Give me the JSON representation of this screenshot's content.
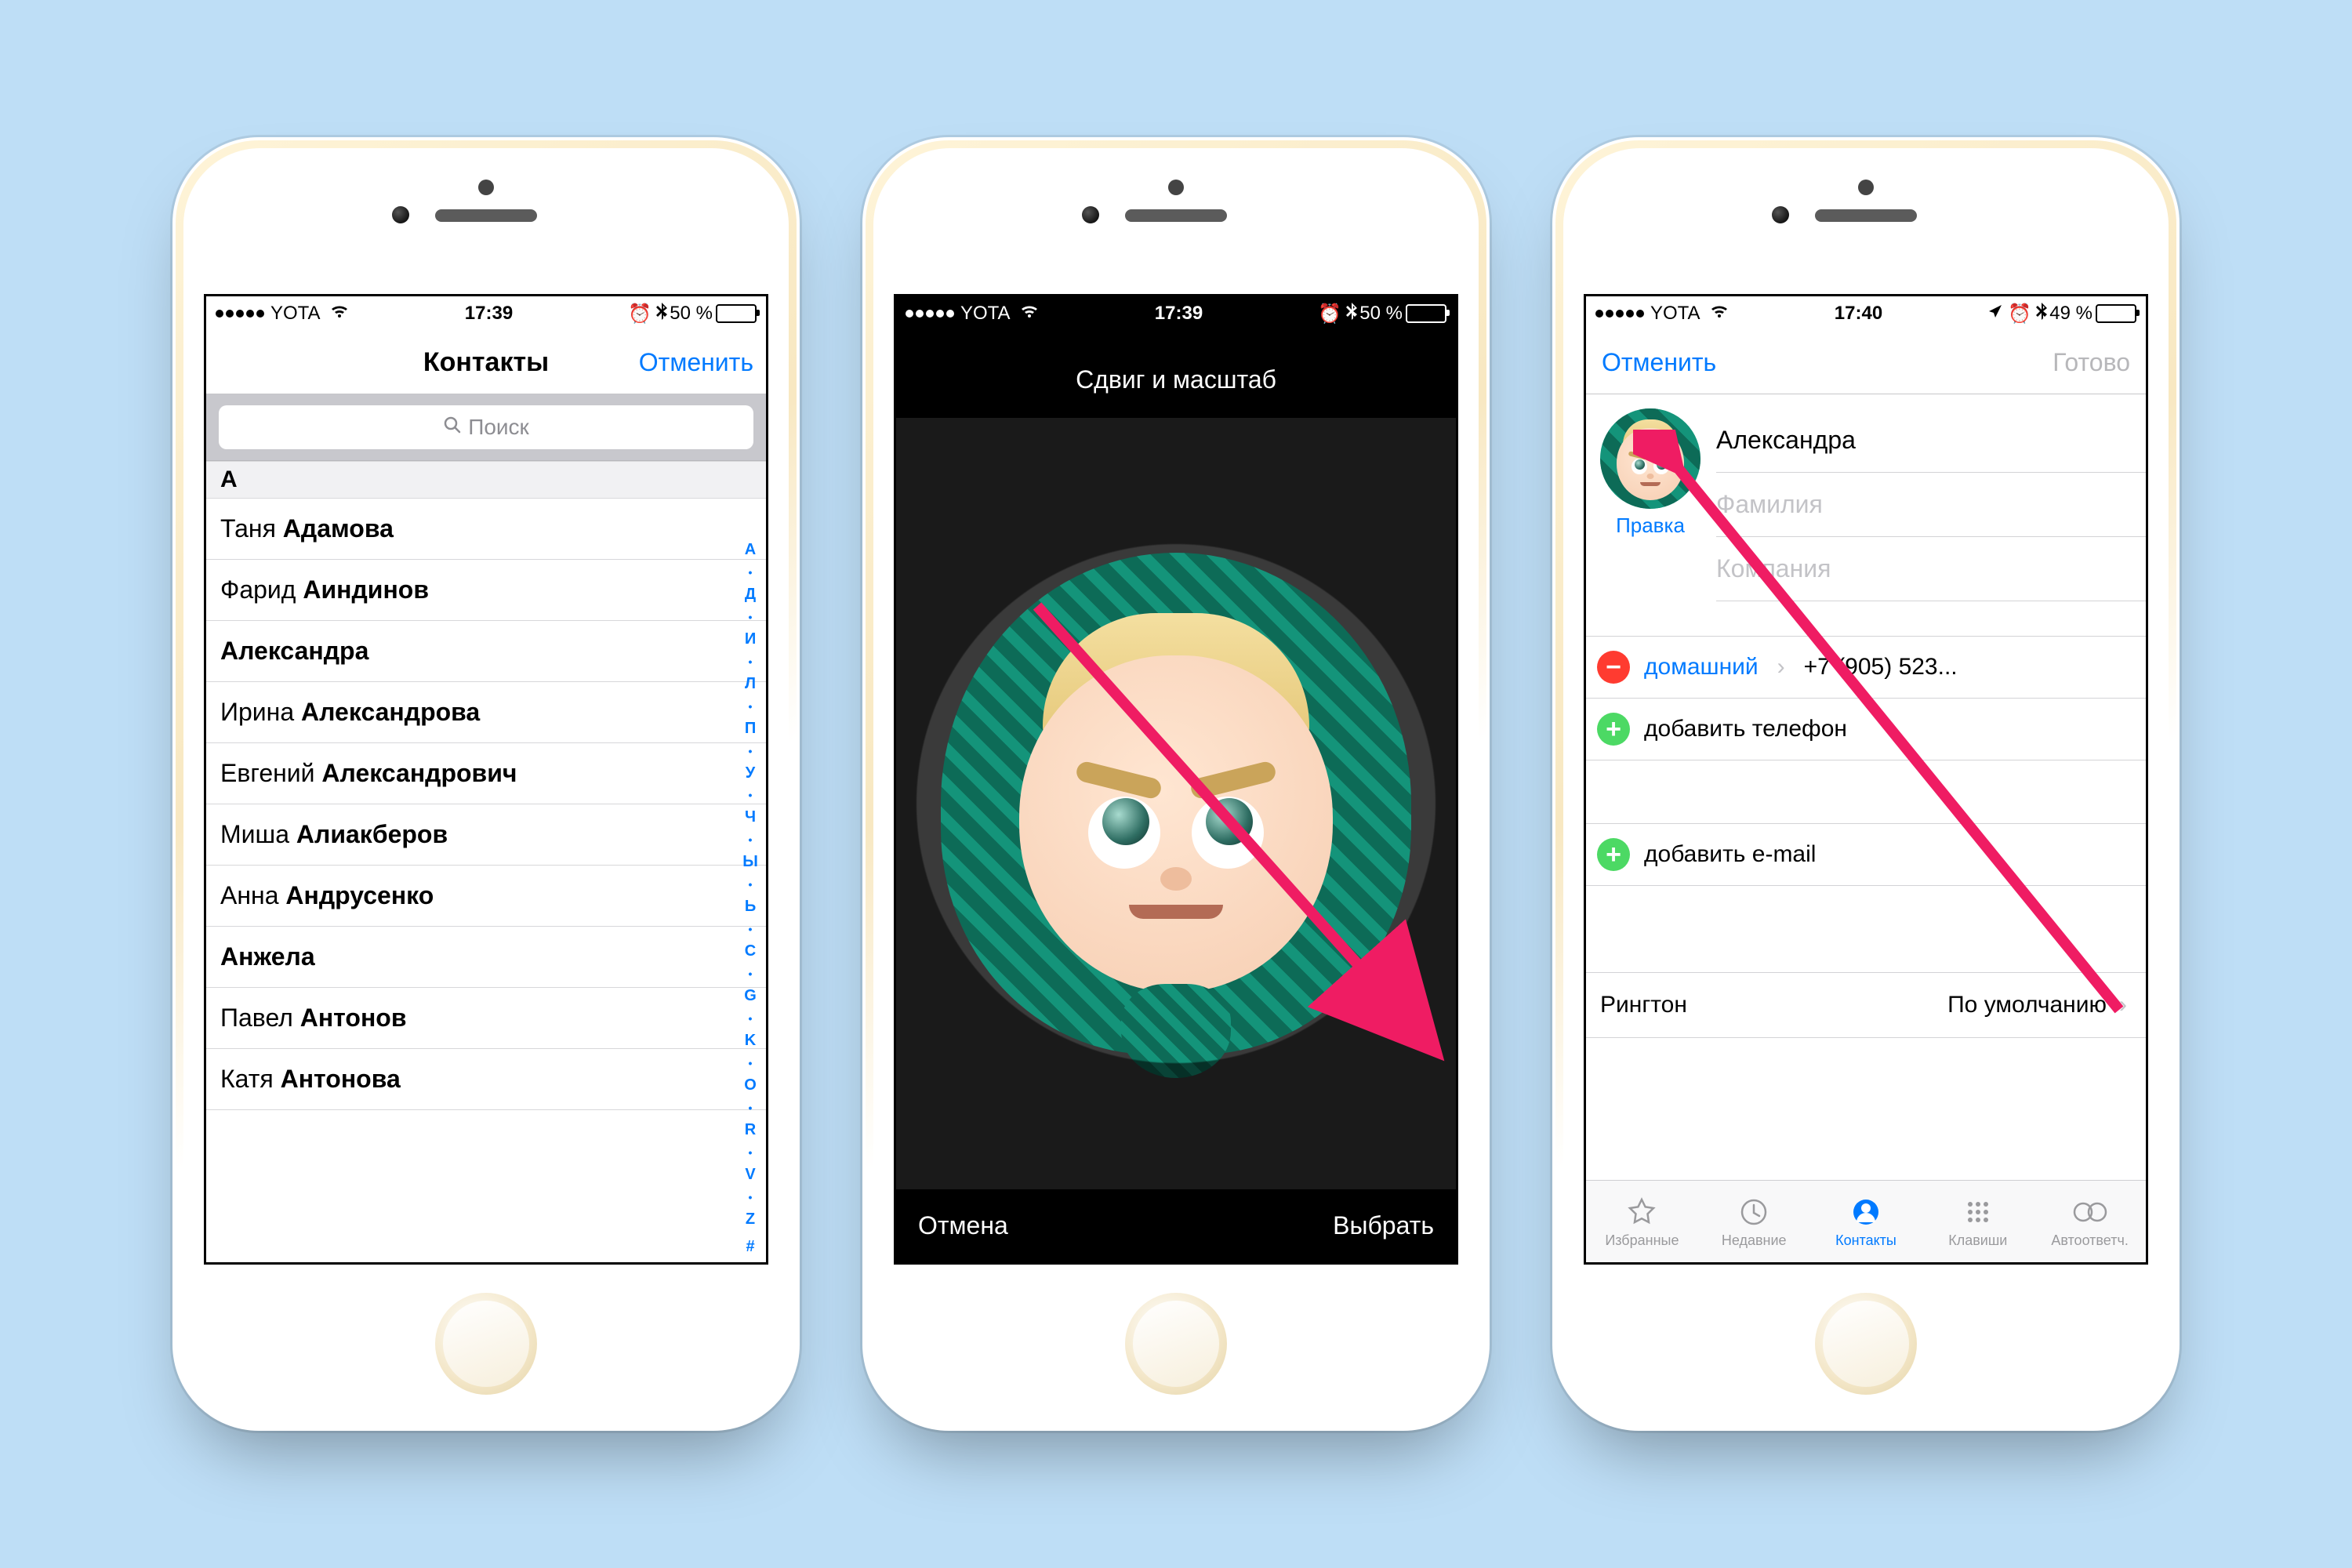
{
  "screen1": {
    "status": {
      "carrier": "YOTA",
      "time": "17:39",
      "icons": "⏰ ✽",
      "battery_pct": "50 %",
      "battery_fill": 50
    },
    "nav_title": "Контакты",
    "nav_cancel": "Отменить",
    "search_placeholder": "Поиск",
    "section": "А",
    "rows": [
      {
        "first": "Таня ",
        "last": "Адамова"
      },
      {
        "first": "Фарид ",
        "last": "Аиндинов"
      },
      {
        "first": "",
        "last": "Александра"
      },
      {
        "first": "Ирина ",
        "last": "Александрова"
      },
      {
        "first": "Евгений ",
        "last": "Александрович"
      },
      {
        "first": "Миша ",
        "last": "Алиакберов"
      },
      {
        "first": "Анна ",
        "last": "Андрусенко"
      },
      {
        "first": "",
        "last": "Анжела"
      },
      {
        "first": "Павел ",
        "last": "Антонов"
      },
      {
        "first": "Катя ",
        "last": "Антонова"
      }
    ],
    "index": [
      "А",
      "•",
      "Д",
      "•",
      "И",
      "•",
      "Л",
      "•",
      "П",
      "•",
      "У",
      "•",
      "Ч",
      "•",
      "Ы",
      "•",
      "Ь",
      "•",
      "C",
      "•",
      "G",
      "•",
      "K",
      "•",
      "O",
      "•",
      "R",
      "•",
      "V",
      "•",
      "Z",
      "#"
    ]
  },
  "screen2": {
    "title": "Сдвиг и масштаб",
    "cancel": "Отмена",
    "choose": "Выбрать"
  },
  "screen3": {
    "status": {
      "carrier": "YOTA",
      "time": "17:40",
      "icons": "➤ ⏰ ✽",
      "battery_pct": "49 %",
      "battery_fill": 49
    },
    "nav_cancel": "Отменить",
    "nav_done": "Готово",
    "edit_photo": "Правка",
    "first_name": "Александра",
    "last_name_ph": "Фамилия",
    "company_ph": "Компания",
    "phone_type": "домашний",
    "phone_value": "+7 (905) 523...",
    "add_phone": "добавить телефон",
    "add_email": "добавить e-mail",
    "ringtone_label": "Рингтон",
    "ringtone_value": "По умолчанию",
    "tabs": [
      {
        "label": "Избранные",
        "icon": "☆"
      },
      {
        "label": "Недавние",
        "icon": "◷"
      },
      {
        "label": "Контакты",
        "icon": "◉",
        "active": true
      },
      {
        "label": "Клавиши",
        "icon": "⠿"
      },
      {
        "label": "Автоответч.",
        "icon": "⚇"
      }
    ]
  }
}
